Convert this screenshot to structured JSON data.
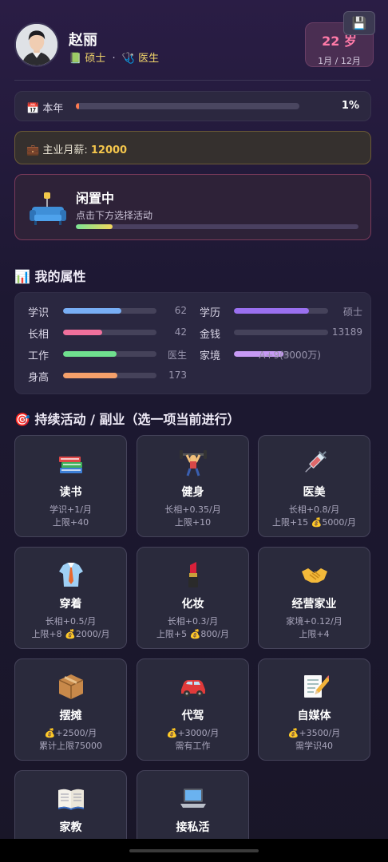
{
  "profile": {
    "name": "赵丽",
    "degree": "硕士",
    "separator": "·",
    "job": "医生",
    "age": "22 岁",
    "month": "1月 / 12月"
  },
  "year": {
    "label": "本年",
    "percent_text": "1%",
    "progress": 0.01
  },
  "salary": {
    "label": "主业月薪:",
    "value": "12000"
  },
  "status": {
    "title": "闲置中",
    "subtitle": "点击下方选择活动",
    "progress": 0.13
  },
  "attributes_title": "我的属性",
  "attributes": [
    {
      "label": "学识",
      "value": "62",
      "fill": 0.62,
      "color": "#78aef5"
    },
    {
      "label": "学历",
      "value": "硕士",
      "fill": 0.8,
      "color": "#9a70f0"
    },
    {
      "label": "长相",
      "value": "42",
      "fill": 0.42,
      "color": "#f0709c"
    },
    {
      "label": "金钱",
      "value": "13189",
      "fill": 0.0,
      "color": "#f4c64c"
    },
    {
      "label": "工作",
      "value": "医生",
      "fill": 0.57,
      "color": "#6fe08e"
    },
    {
      "label": "家境",
      "value": "A+9(3000万)",
      "fill": 0.88,
      "color": "#c79af5"
    },
    {
      "label": "身高",
      "value": "173",
      "fill": 0.58,
      "color": "#f5a06a"
    }
  ],
  "activities_title": "持续活动 / 副业（选一项当前进行）",
  "activities": [
    {
      "icon": "books-icon",
      "name": "读书",
      "line1": "学识+1/月",
      "line2": "上限+40"
    },
    {
      "icon": "weightlifter-icon",
      "name": "健身",
      "line1": "长相+0.35/月",
      "line2": "上限+10"
    },
    {
      "icon": "syringe-icon",
      "name": "医美",
      "line1": "长相+0.8/月",
      "line2": "上限+15 💰5000/月"
    },
    {
      "icon": "shirt-icon",
      "name": "穿着",
      "line1": "长相+0.5/月",
      "line2": "上限+8 💰2000/月"
    },
    {
      "icon": "lipstick-icon",
      "name": "化妆",
      "line1": "长相+0.3/月",
      "line2": "上限+5 💰800/月"
    },
    {
      "icon": "handshake-icon",
      "name": "经营家业",
      "line1": "家境+0.12/月",
      "line2": "上限+4"
    },
    {
      "icon": "package-icon",
      "name": "摆摊",
      "line1": "💰+2500/月",
      "line2": "累计上限75000"
    },
    {
      "icon": "car-icon",
      "name": "代驾",
      "line1": "💰+3000/月",
      "line2": "需有工作"
    },
    {
      "icon": "memo-icon",
      "name": "自媒体",
      "line1": "💰+3500/月",
      "line2": "需学识40"
    },
    {
      "icon": "open-book-icon",
      "name": "家教",
      "line1": "",
      "line2": ""
    },
    {
      "icon": "laptop-icon",
      "name": "接私活",
      "line1": "",
      "line2": ""
    }
  ]
}
